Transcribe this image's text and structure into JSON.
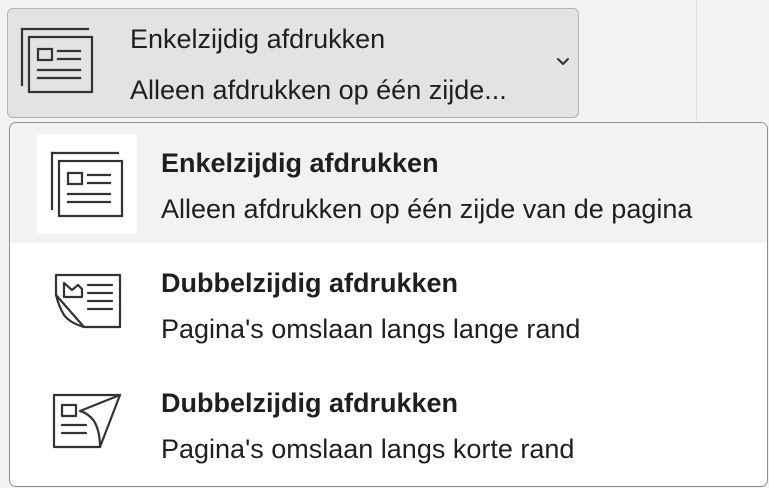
{
  "dropdown": {
    "selected_title": "Enkelzijdig afdrukken",
    "selected_description": "Alleen afdrukken op één zijde...",
    "icon": "single-sided-print-icon",
    "chevron_icon": "chevron-down-icon"
  },
  "menu": {
    "items": [
      {
        "title": "Enkelzijdig afdrukken",
        "description": "Alleen afdrukken op één zijde van de pagina",
        "icon": "single-sided-print-icon",
        "selected": true
      },
      {
        "title": "Dubbelzijdig afdrukken",
        "description": "Pagina's omslaan langs lange rand",
        "icon": "flip-long-edge-icon",
        "selected": false
      },
      {
        "title": "Dubbelzijdig afdrukken",
        "description": "Pagina's omslaan langs korte rand",
        "icon": "flip-short-edge-icon",
        "selected": false
      }
    ]
  },
  "colors": {
    "dropdown_background": "#e3e3e3",
    "selected_item_background": "#f2f2f2",
    "text": "#1f1f1f",
    "icon_stroke": "#333333"
  }
}
